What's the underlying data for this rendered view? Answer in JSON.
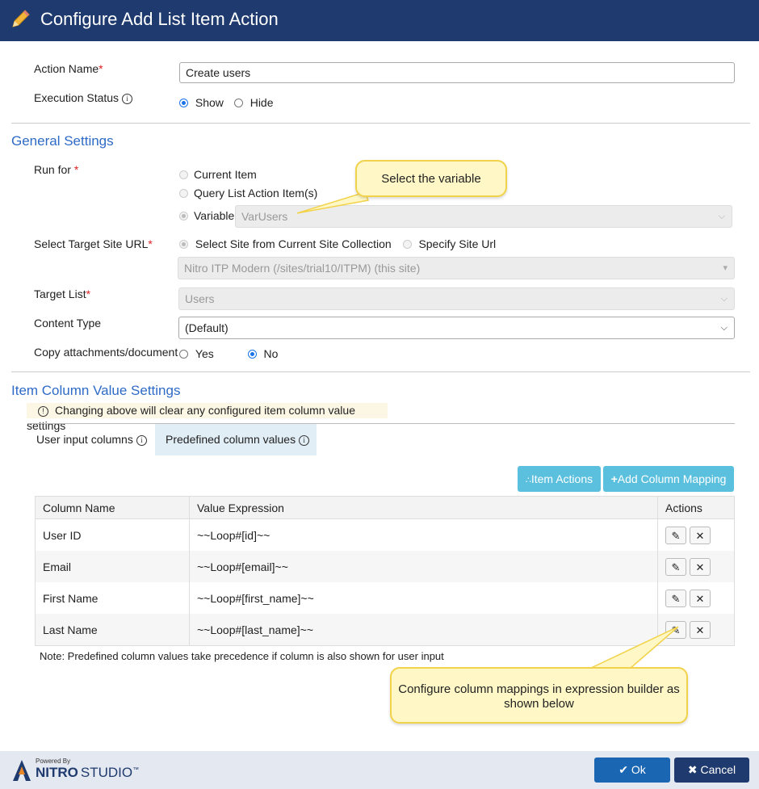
{
  "header": {
    "title": "Configure Add List Item Action"
  },
  "action_name": {
    "label": "Action Name",
    "required_mark": "*",
    "value": "Create users"
  },
  "execution_status": {
    "label": "Execution Status",
    "info": "i",
    "options": [
      "Show",
      "Hide"
    ],
    "selected": "Show"
  },
  "general": {
    "title": "General Settings",
    "run_for": {
      "label": "Run for",
      "required_mark": "*",
      "options": [
        "Current Item",
        "Query List Action Item(s)",
        "Variable"
      ],
      "selected": "Variable",
      "variable_value": "VarUsers"
    },
    "target_site": {
      "label": "Select Target Site URL",
      "required_mark": "*",
      "options": [
        "Select Site from Current Site Collection",
        "Specify Site Url"
      ],
      "selected": "Select Site from Current Site Collection",
      "site_value": "Nitro ITP Modern (/sites/trial10/ITPM) (this site)"
    },
    "target_list": {
      "label": "Target List",
      "required_mark": "*",
      "value": "Users"
    },
    "content_type": {
      "label": "Content Type",
      "value": "(Default)"
    },
    "copy_attachments": {
      "label": "Copy attachments/document",
      "options": [
        "Yes",
        "No"
      ],
      "selected": "No"
    }
  },
  "item_columns": {
    "title": "Item Column Value Settings",
    "warning": "Changing above will clear any configured item column value settings",
    "tabs": [
      "User input columns",
      "Predefined column values"
    ],
    "active_tab": "Predefined column values",
    "btn_item_actions": "Item Actions",
    "btn_add_mapping": "Add Column Mapping",
    "table": {
      "headers": [
        "Column Name",
        "Value Expression",
        "Actions"
      ],
      "rows": [
        {
          "name": "User ID",
          "expr": "~~Loop#[id]~~"
        },
        {
          "name": "Email",
          "expr": "~~Loop#[email]~~"
        },
        {
          "name": "First Name",
          "expr": "~~Loop#[first_name]~~"
        },
        {
          "name": "Last Name",
          "expr": "~~Loop#[last_name]~~"
        }
      ]
    },
    "note": "Note: Predefined column values take precedence if column is also shown for user input"
  },
  "callouts": {
    "variable": "Select the variable",
    "mapping": "Configure column mappings in expression builder as shown below"
  },
  "footer": {
    "logo_powered": "Powered By",
    "logo_brand": "NITRO",
    "logo_studio": "STUDIO",
    "logo_tm": "™",
    "ok": "Ok",
    "cancel": "Cancel"
  },
  "icons": {
    "edit": "pencil-icon",
    "delete": "close-icon",
    "info": "info-icon",
    "item_actions": "sitemap-icon",
    "add": "plus-icon",
    "ok": "check-icon",
    "cancel": "close-icon"
  },
  "colors": {
    "header": "#1f3a6e",
    "accent": "#2e6bc6",
    "button_cyan": "#5bc0de",
    "ok": "#1a66b3",
    "callout_bg": "#fff8c6"
  }
}
